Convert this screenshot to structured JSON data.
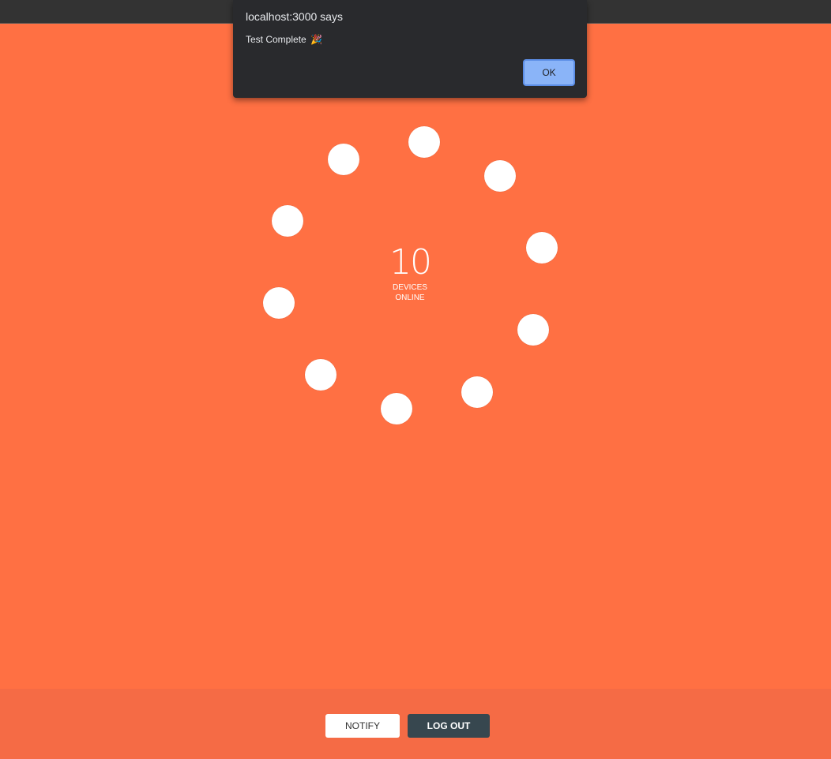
{
  "dialog": {
    "title": "localhost:3000 says",
    "message": "Test Complete",
    "emoji": "🎉",
    "ok_label": "OK"
  },
  "status": {
    "count": "10",
    "label_line1": "DEVICES",
    "label_line2": "ONLINE"
  },
  "footer": {
    "notify_label": "NOTIFY",
    "logout_label": "LOG OUT"
  },
  "colors": {
    "background": "#ff7043",
    "footer": "#f56b45",
    "dialog": "#292a2d",
    "ok_button": "#8ab4f8",
    "logout_button": "#37474f"
  }
}
